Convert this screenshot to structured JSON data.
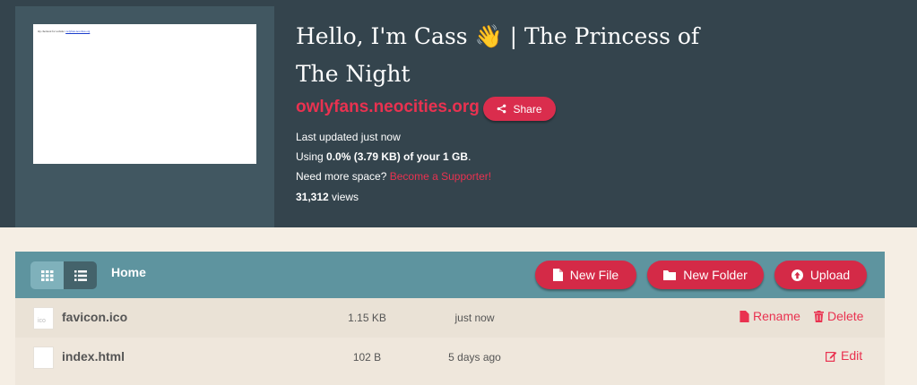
{
  "site": {
    "title": "Hello, I'm Cass",
    "title_emoji": "👋",
    "title_rest": " | The Princess of The Night",
    "domain": "owlyfans.neocities.org",
    "share_label": "Share",
    "thumbnail_text": "my checkout for website:",
    "thumbnail_link": "owlyfans.neocities.org"
  },
  "info": {
    "last_updated": "Last updated just now",
    "using_prefix": "Using ",
    "usage": "0.0% (3.79 KB) of your 1 GB",
    "using_suffix": ".",
    "need_space": "Need more space? ",
    "supporter_link": "Become a Supporter!",
    "views_count": "31,312",
    "views_label": " views"
  },
  "toolbar": {
    "breadcrumb": "Home",
    "new_file": "New File",
    "new_folder": "New Folder",
    "upload": "Upload"
  },
  "files": [
    {
      "name": "favicon.ico",
      "icon_label": "ico",
      "size": "1.15 KB",
      "updated": "just now",
      "actions": [
        "Rename",
        "Delete"
      ]
    },
    {
      "name": "index.html",
      "icon_label": "",
      "size": "102 B",
      "updated": "5 days ago",
      "actions": [
        "Edit"
      ]
    }
  ],
  "colors": {
    "header_bg": "#34444d",
    "accent": "#e93250",
    "toolbar_bg": "#5e949f",
    "page_bg": "#f5eee4"
  }
}
